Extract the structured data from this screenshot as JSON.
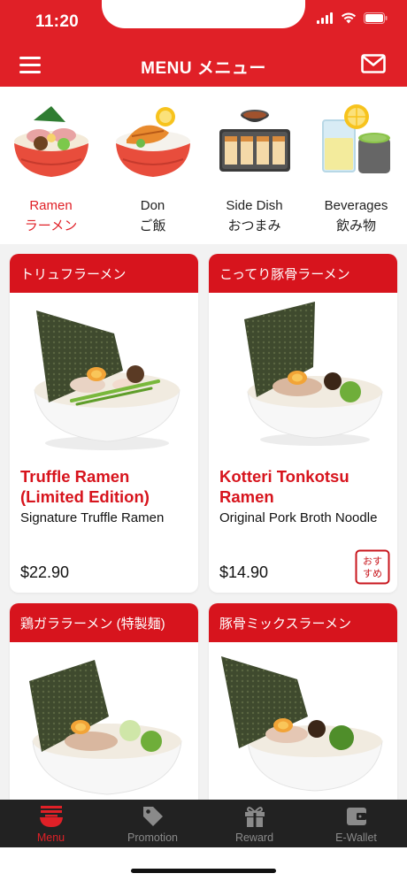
{
  "status_bar": {
    "time": "11:20"
  },
  "header": {
    "title": "MENU メニュー"
  },
  "categories": [
    {
      "en": "Ramen",
      "jp": "ラーメン",
      "icon": "ramen-bowl-icon",
      "active": true
    },
    {
      "en": "Don",
      "jp": "ご飯",
      "icon": "don-bowl-icon",
      "active": false
    },
    {
      "en": "Side Dish",
      "jp": "おつまみ",
      "icon": "gyoza-icon",
      "active": false
    },
    {
      "en": "Beverages",
      "jp": "飲み物",
      "icon": "drinks-icon",
      "active": false
    }
  ],
  "menu_items": [
    {
      "jp_title": "トリュフラーメン",
      "name": "Truffle Ramen (Limited Edition)",
      "desc": "Signature Truffle Ramen",
      "price": "$22.90",
      "recommended": false
    },
    {
      "jp_title": "こってり豚骨ラーメン",
      "name": "Kotteri Tonkotsu Ramen",
      "desc": "Original Pork Broth Noodle",
      "price": "$14.90",
      "recommended": true,
      "stamp_text": "おすすめ"
    },
    {
      "jp_title": "鶏ガララーメン (特製麺)",
      "name": "",
      "desc": "",
      "price": ""
    },
    {
      "jp_title": "豚骨ミックスラーメン",
      "name": "",
      "desc": "",
      "price": ""
    }
  ],
  "bottom_nav": [
    {
      "label": "Menu",
      "icon": "ramen-menu-icon",
      "active": true
    },
    {
      "label": "Promotion",
      "icon": "tag-icon",
      "active": false
    },
    {
      "label": "Reward",
      "icon": "gift-icon",
      "active": false
    },
    {
      "label": "E-Wallet",
      "icon": "wallet-icon",
      "active": false
    }
  ],
  "colors": {
    "brand_red": "#e02027",
    "card_header_red": "#d7141d",
    "nav_bg": "#222222",
    "inactive_gray": "#8a8a8a"
  }
}
